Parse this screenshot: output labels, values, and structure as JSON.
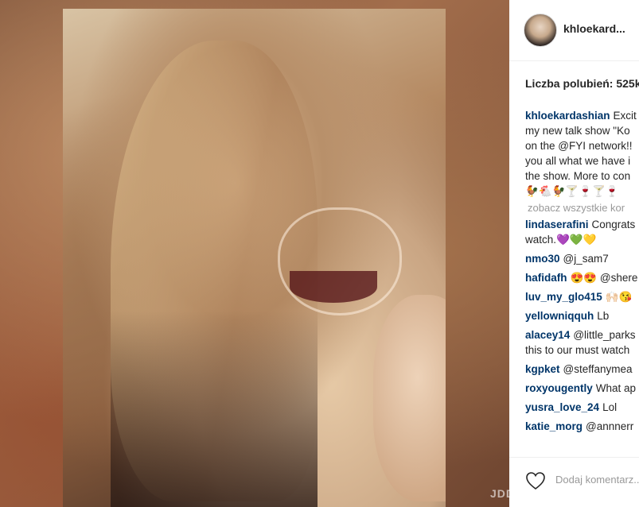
{
  "post": {
    "username": "khloekard...",
    "likes_label": "Liczba polubień: 525k",
    "caption_user": "khloekardashian",
    "caption_lines": [
      "Excit",
      "my new talk show \"Ko",
      "on the @FYI network!!",
      "you all what we have i",
      "the show. More to con",
      "🐓🐔🐓🍸🍷🍸🍷"
    ],
    "view_all": "zobacz wszystkie kor",
    "comments": [
      {
        "user": "lindaserafini",
        "text": "Congrats",
        "text2": "watch.💜💚💛"
      },
      {
        "user": "nmo30",
        "text": "@j_sam7"
      },
      {
        "user": "hafidafh",
        "text": "😍😍 @shere"
      },
      {
        "user": "luv_my_glo415",
        "text": "🙌🏻😘"
      },
      {
        "user": "yellowniqquh",
        "text": "Lb"
      },
      {
        "user": "alacey14",
        "text": "@little_parks",
        "text2": "this to our must watch"
      },
      {
        "user": "kgpket",
        "text": "@steffanymea"
      },
      {
        "user": "roxyougently",
        "text": "What ap"
      },
      {
        "user": "yusra_love_24",
        "text": "Lol"
      },
      {
        "user": "katie_morg",
        "text": "@annnerr"
      }
    ],
    "add_comment_placeholder": "Dodaj komentarz...",
    "watermark": "JDD"
  },
  "colors": {
    "username": "#003569",
    "text": "#262626",
    "muted": "#999999"
  },
  "icons": {
    "like": "heart-outline-icon"
  }
}
